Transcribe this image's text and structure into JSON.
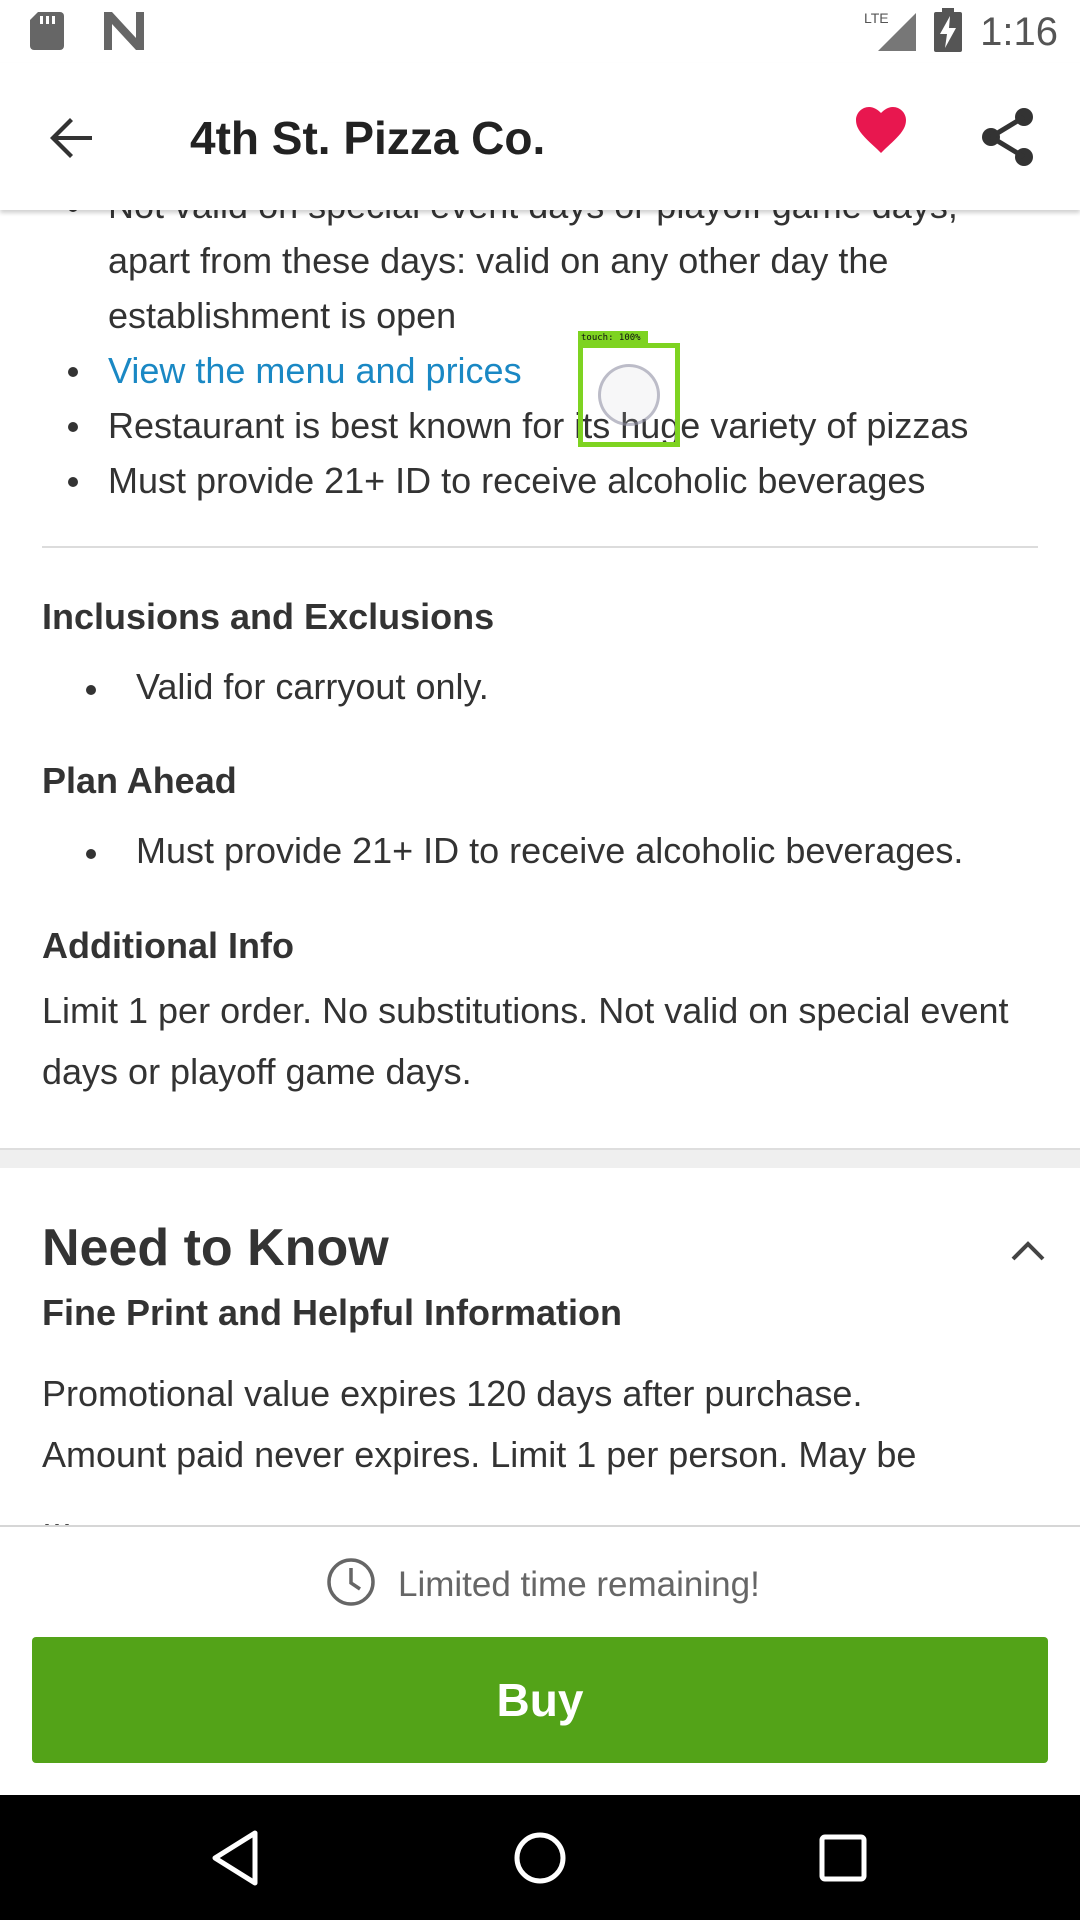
{
  "status_bar": {
    "time": "1:16",
    "network": "LTE",
    "icons": [
      "sd-card-icon",
      "n-logo-icon",
      "signal-icon",
      "battery-charging-icon"
    ]
  },
  "app_bar": {
    "title": "4th St. Pizza Co.",
    "icons": [
      "back-arrow-icon",
      "heart-icon",
      "share-icon"
    ],
    "heart_color": "#e8174f"
  },
  "highlights": {
    "items": [
      "Not valid on special event days or playoff game days,",
      "apart from these days: valid on any other day the establishment is open",
      "View the menu and prices",
      "Restaurant is best known for its huge variety of pizzas",
      "Must provide 21+ ID to receive alcoholic beverages"
    ]
  },
  "inclusions": {
    "heading": "Inclusions and Exclusions",
    "items": [
      "Valid for carryout only."
    ]
  },
  "plan_ahead": {
    "heading": "Plan Ahead",
    "items": [
      "Must provide 21+ ID to receive alcoholic beverages."
    ]
  },
  "additional_info": {
    "heading": "Additional Info",
    "text": "Limit 1 per order. No substitutions. Not valid on special event days or playoff game days."
  },
  "need_to_know": {
    "heading": "Need to Know",
    "subheading": "Fine Print and Helpful Information",
    "text_line1": "Promotional value expires 120 days after purchase.",
    "text_line2": "Amount paid never expires. Limit 1 per person. May be",
    "text_line3": "...",
    "toggle_icon": "chevron-up-icon"
  },
  "touch_overlay": {
    "label": "touch: 100%"
  },
  "buy_panel": {
    "timer_text": "Limited time remaining!",
    "timer_icon": "clock-icon",
    "buy_label": "Buy",
    "buy_color": "#53a318"
  },
  "nav_bar": {
    "icons": [
      "nav-back-icon",
      "nav-home-icon",
      "nav-recents-icon"
    ]
  }
}
